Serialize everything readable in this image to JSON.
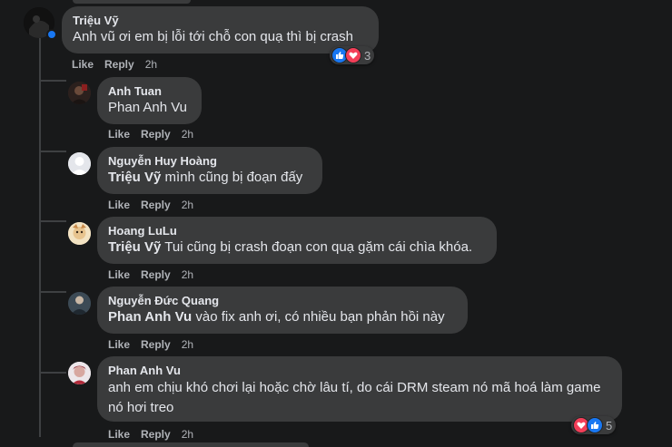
{
  "actions": {
    "like": "Like",
    "reply": "Reply"
  },
  "root": {
    "author": "Triệu Vỹ",
    "text": "Anh vũ ơi em bị lỗi tới chỗ con quạ thì bị crash",
    "time": "2h",
    "reaction_count": "3",
    "reactions": [
      "like-reaction-icon",
      "love-reaction-icon"
    ]
  },
  "replies": [
    {
      "author": "Anh Tuan",
      "mention": "",
      "text": "Phan Anh Vu",
      "time": "2h"
    },
    {
      "author": "Nguyễn Huy Hoàng",
      "mention": "Triệu Vỹ",
      "text": " mình cũng bị đoạn đấy",
      "time": "2h"
    },
    {
      "author": "Hoang LuLu",
      "mention": "Triệu Vỹ",
      "text": " Tui cũng bị crash đoạn con quạ gặm cái chìa khóa.",
      "time": "2h"
    },
    {
      "author": "Nguyễn Đức Quang",
      "mention": "Phan Anh Vu",
      "text": " vào fix anh ơi, có nhiều bạn phản hồi này",
      "time": "2h"
    },
    {
      "author": "Phan Anh Vu",
      "mention": "",
      "text": "anh em chịu khó chơi lại hoặc chờ lâu tí, do cái DRM steam nó mã hoá làm game nó hơi treo",
      "time": "2h",
      "reaction_count": "5",
      "reactions": [
        "love-reaction-icon",
        "like-reaction-icon"
      ]
    }
  ],
  "colors": {
    "background": "#18191a",
    "bubble": "#3a3b3c",
    "text": "#e4e6eb",
    "secondary": "#b0b3b8",
    "like": "#1877f2",
    "love": "#f33e58",
    "online": "#31a24c"
  }
}
